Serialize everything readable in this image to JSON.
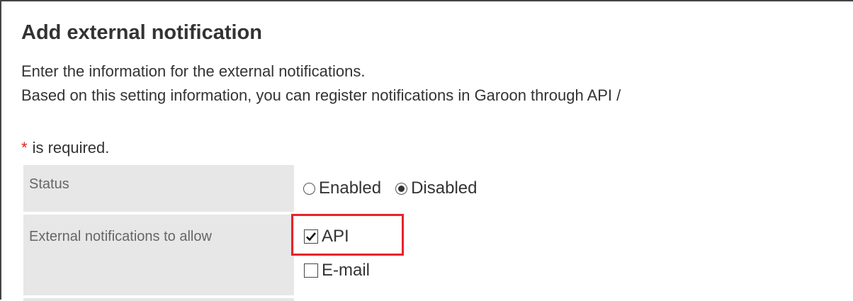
{
  "title": "Add external notification",
  "description": [
    "Enter the information for the external notifications.",
    "Based on this setting information, you can register notifications in Garoon through API /"
  ],
  "required_note": {
    "star": "*",
    "text": "is required."
  },
  "form": {
    "status": {
      "label": "Status",
      "options": [
        {
          "label": "Enabled",
          "selected": false
        },
        {
          "label": "Disabled",
          "selected": true
        }
      ]
    },
    "external_notifications": {
      "label": "External notifications to allow",
      "options": [
        {
          "label": "API",
          "checked": true,
          "highlighted": true
        },
        {
          "label": "E-mail",
          "checked": false,
          "highlighted": false
        }
      ]
    }
  },
  "colors": {
    "required_star": "#e02020",
    "highlight_border": "#e8232a",
    "label_background": "#e7e7e7"
  }
}
